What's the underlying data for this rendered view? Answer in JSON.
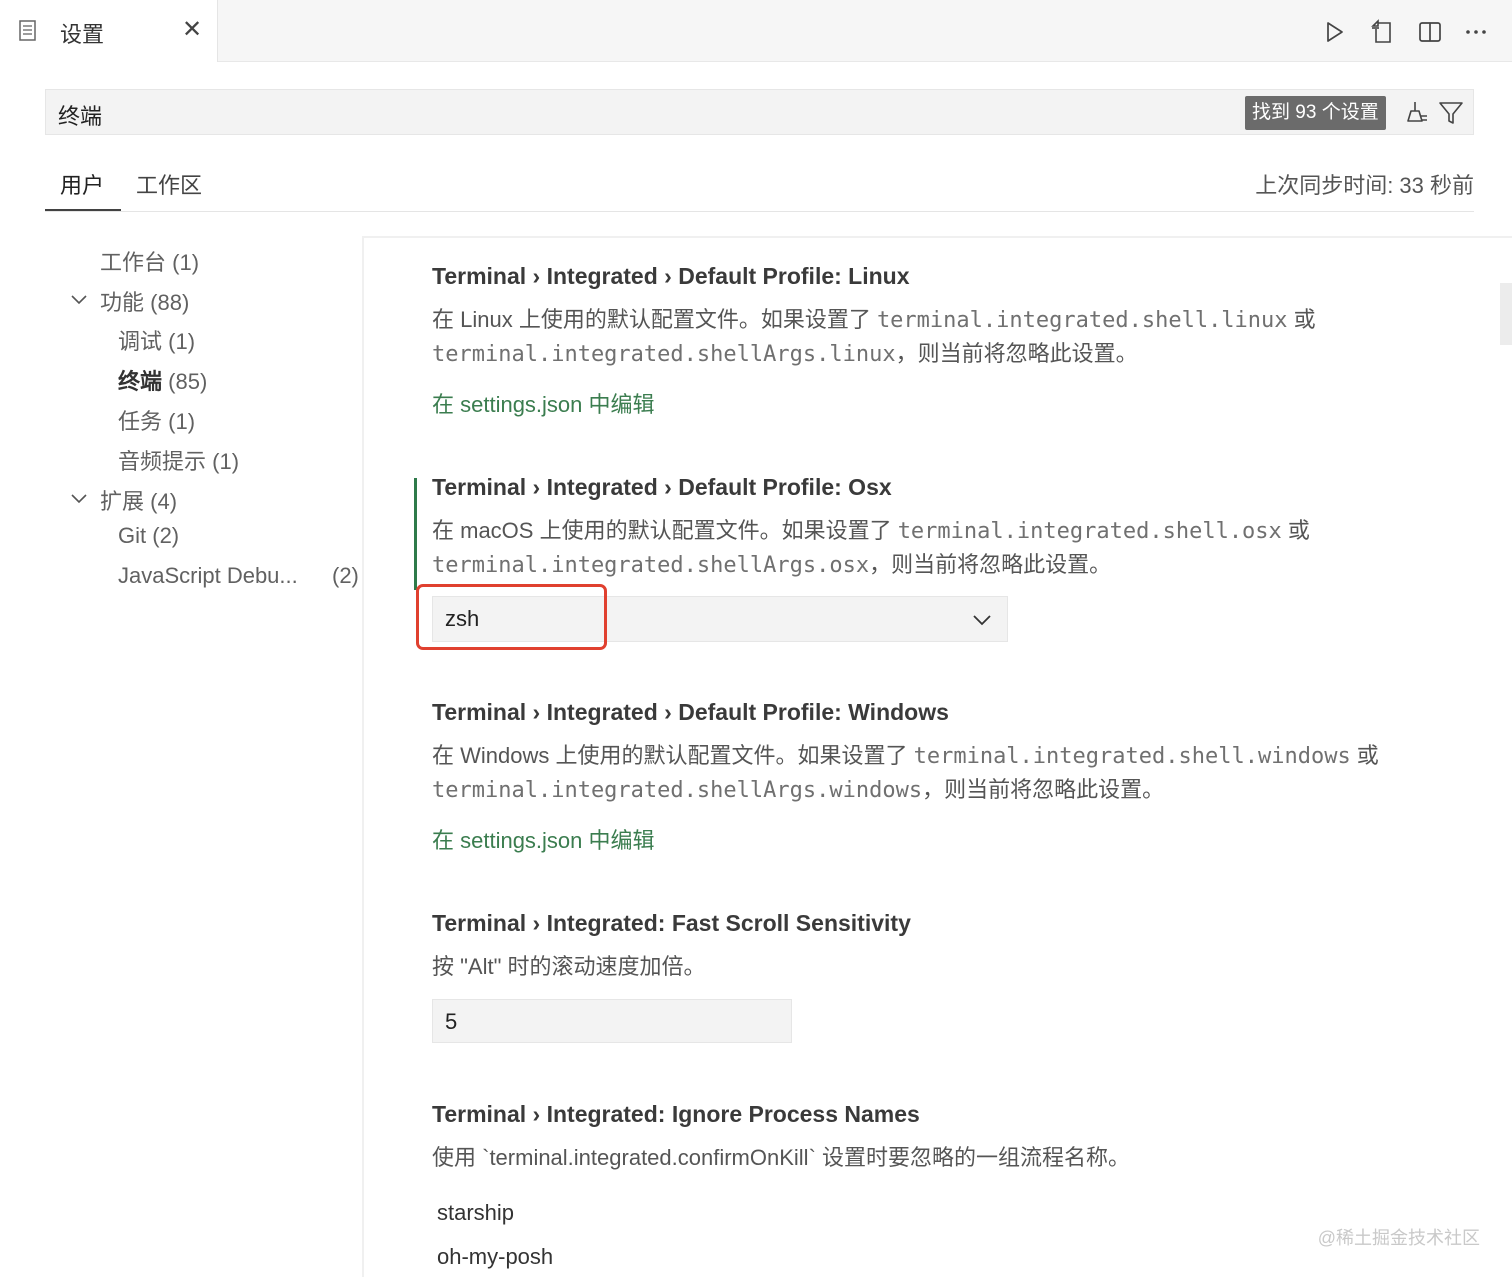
{
  "tab": {
    "title": "设置",
    "close": "✕"
  },
  "search": {
    "value": "终端",
    "result_count": "找到 93 个设置"
  },
  "scope_tabs": {
    "user": "用户",
    "workspace": "工作区"
  },
  "sync_status": "上次同步时间: 33 秒前",
  "toc": {
    "workbench": "工作台",
    "workbench_count": "(1)",
    "features": "功能",
    "features_count": "(88)",
    "debug": "调试",
    "debug_count": "(1)",
    "terminal": "终端",
    "terminal_count": "(85)",
    "tasks": "任务",
    "tasks_count": "(1)",
    "audio_cues": "音频提示",
    "audio_cues_count": "(1)",
    "extensions": "扩展",
    "extensions_count": "(4)",
    "git": "Git",
    "git_count": "(2)",
    "js_debug": "JavaScript Debu...",
    "js_debug_count": "(2)"
  },
  "settings": {
    "linux": {
      "title": "Terminal › Integrated › Default Profile: Linux",
      "desc_prefix": "在 Linux 上使用的默认配置文件。如果设置了 ",
      "desc_code1": "terminal.integrated.shell.linux",
      "desc_mid": " 或",
      "desc_code2": "terminal.integrated.shellArgs.linux",
      "desc_suffix": "，则当前将忽略此设置。",
      "edit_link": "在 settings.json 中编辑"
    },
    "osx": {
      "title": "Terminal › Integrated › Default Profile: Osx",
      "desc_prefix": "在 macOS 上使用的默认配置文件。如果设置了 ",
      "desc_code1": "terminal.integrated.shell.osx",
      "desc_mid": " 或",
      "desc_code2": "terminal.integrated.shellArgs.osx",
      "desc_suffix": "，则当前将忽略此设置。",
      "selected_value": "zsh"
    },
    "windows": {
      "title": "Terminal › Integrated › Default Profile: Windows",
      "desc_prefix": "在 Windows 上使用的默认配置文件。如果设置了 ",
      "desc_code1": "terminal.integrated.shell.windows",
      "desc_mid": " 或",
      "desc_code2": "terminal.integrated.shellArgs.windows",
      "desc_suffix": "，则当前将忽略此设置。",
      "edit_link": "在 settings.json 中编辑"
    },
    "fast_scroll": {
      "title": "Terminal › Integrated: Fast Scroll Sensitivity",
      "desc": "按 \"Alt\" 时的滚动速度加倍。",
      "value": "5"
    },
    "ignore_process": {
      "title": "Terminal › Integrated: Ignore Process Names",
      "desc": "使用 `terminal.integrated.confirmOnKill` 设置时要忽略的一组流程名称。",
      "items": [
        "starship",
        "oh-my-posh"
      ]
    }
  },
  "watermark": "@稀土掘金技术社区",
  "icons": {
    "tab": "settings-file-icon",
    "run": "run-icon",
    "open_json": "open-settings-json-icon",
    "split": "split-editor-icon",
    "more": "more-actions-icon",
    "clear": "clear-search-icon",
    "filter": "filter-icon"
  },
  "colors": {
    "accent_green": "#3b7d4f",
    "focus_bar": "#2f7a4a",
    "highlight_red": "#e0402f",
    "badge_bg": "#6b6b6b"
  }
}
